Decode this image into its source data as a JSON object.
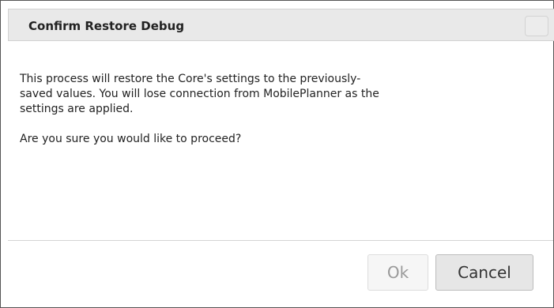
{
  "dialog": {
    "title": "Confirm Restore Debug",
    "message_lines": [
      "This process will restore the Core's settings to the previously-",
      "saved values. You will lose connection from MobilePlanner as the",
      "settings are applied."
    ],
    "question": "Are you sure you would like to proceed?",
    "buttons": {
      "ok_label": "Ok",
      "cancel_label": "Cancel"
    },
    "close_icon": "close-icon"
  },
  "colors": {
    "titlebar_bg": "#e9e9e9",
    "ok_text_disabled": "#999999",
    "cancel_bg": "#e6e6e6"
  }
}
